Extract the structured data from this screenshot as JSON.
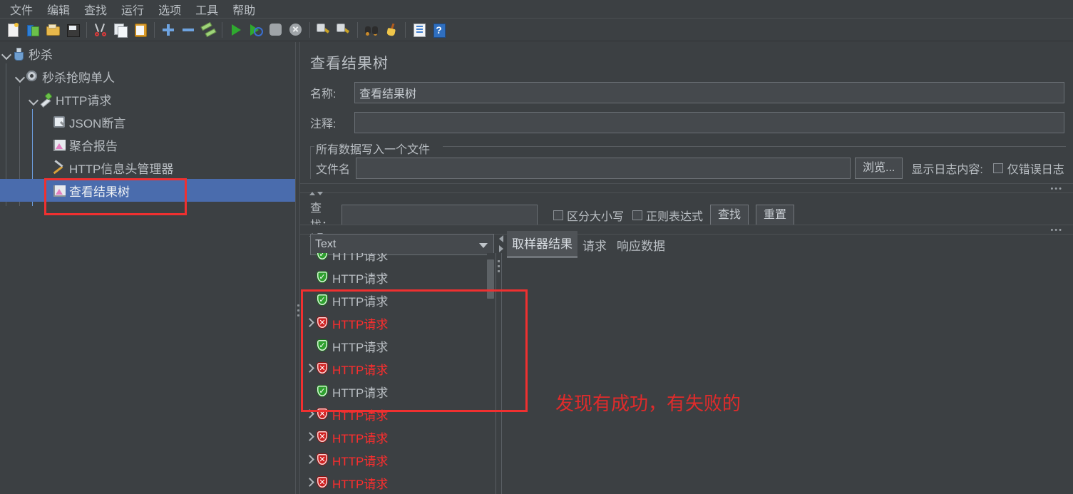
{
  "menu": {
    "items": [
      "文件",
      "编辑",
      "查找",
      "运行",
      "选项",
      "工具",
      "帮助"
    ]
  },
  "toolbar": {
    "groups": [
      [
        "new-document-icon",
        "templates-icon",
        "open-folder-icon",
        "save-icon"
      ],
      [
        "cut-icon",
        "copy-icon",
        "paste-icon"
      ],
      [
        "expand-plus-icon",
        "collapse-minus-icon",
        "toggle-icon"
      ],
      [
        "start-icon",
        "start-no-timers-icon",
        "stop-icon",
        "shutdown-icon"
      ],
      [
        "clear-icon",
        "clear-all-icon"
      ],
      [
        "search-icon",
        "reset-search-icon"
      ],
      [
        "function-helper-icon",
        "help-icon"
      ]
    ]
  },
  "tree": {
    "nodes": [
      {
        "label": "秒杀",
        "icon": "test-plan-icon",
        "depth": 0,
        "twisty": "open",
        "selected": false
      },
      {
        "label": "秒杀抢购单人",
        "icon": "thread-group-icon",
        "depth": 1,
        "twisty": "open",
        "selected": false
      },
      {
        "label": "HTTP请求",
        "icon": "http-sampler-icon",
        "depth": 2,
        "twisty": "open",
        "selected": false
      },
      {
        "label": "JSON断言",
        "icon": "json-assertion-icon",
        "depth": 3,
        "twisty": "none",
        "selected": false
      },
      {
        "label": "聚合报告",
        "icon": "aggregate-report-icon",
        "depth": 3,
        "twisty": "none",
        "selected": false
      },
      {
        "label": "HTTP信息头管理器",
        "icon": "header-manager-icon",
        "depth": 3,
        "twisty": "none",
        "selected": false
      },
      {
        "label": "查看结果树",
        "icon": "view-results-tree-icon",
        "depth": 3,
        "twisty": "none",
        "selected": true
      }
    ]
  },
  "panel": {
    "title": "查看结果树",
    "name_label": "名称:",
    "name_value": "查看结果树",
    "comment_label": "注释:",
    "comment_value": "",
    "file_group_title": "所有数据写入一个文件",
    "filename_label": "文件名",
    "filename_value": "",
    "browse_button": "浏览...",
    "log_display_label": "显示日志内容:",
    "errors_only_label": "仅错误日志",
    "errors_only_checked": false
  },
  "search": {
    "label": "查找：",
    "value": "",
    "case_sensitive_label": "区分大小写",
    "case_sensitive_checked": false,
    "regex_label": "正则表达式",
    "regex_checked": false,
    "find_button": "查找",
    "reset_button": "重置"
  },
  "renderer": {
    "selected": "Text"
  },
  "tabs": {
    "items": [
      {
        "label": "取样器结果",
        "active": true
      },
      {
        "label": "请求",
        "active": false
      },
      {
        "label": "响应数据",
        "active": false
      }
    ]
  },
  "results": {
    "rows": [
      {
        "label": "HTTP请求",
        "status": "ok",
        "expandable": false,
        "clipped": true
      },
      {
        "label": "HTTP请求",
        "status": "ok",
        "expandable": false
      },
      {
        "label": "HTTP请求",
        "status": "ok",
        "expandable": false
      },
      {
        "label": "HTTP请求",
        "status": "fail",
        "expandable": true
      },
      {
        "label": "HTTP请求",
        "status": "ok",
        "expandable": false
      },
      {
        "label": "HTTP请求",
        "status": "fail",
        "expandable": true
      },
      {
        "label": "HTTP请求",
        "status": "ok",
        "expandable": false
      },
      {
        "label": "HTTP请求",
        "status": "fail",
        "expandable": true
      },
      {
        "label": "HTTP请求",
        "status": "fail",
        "expandable": true
      },
      {
        "label": "HTTP请求",
        "status": "fail",
        "expandable": true
      },
      {
        "label": "HTTP请求",
        "status": "fail",
        "expandable": true
      }
    ]
  },
  "annotations": {
    "note_text": "发现有成功，有失败的",
    "highlight_color": "#f03030",
    "note_color": "#e02b2b"
  },
  "colors": {
    "background": "#3c4043",
    "selection": "#4a6cad",
    "text": "#b9bec3",
    "fail_text": "#ff2d2d",
    "field_bg": "#45494d"
  }
}
